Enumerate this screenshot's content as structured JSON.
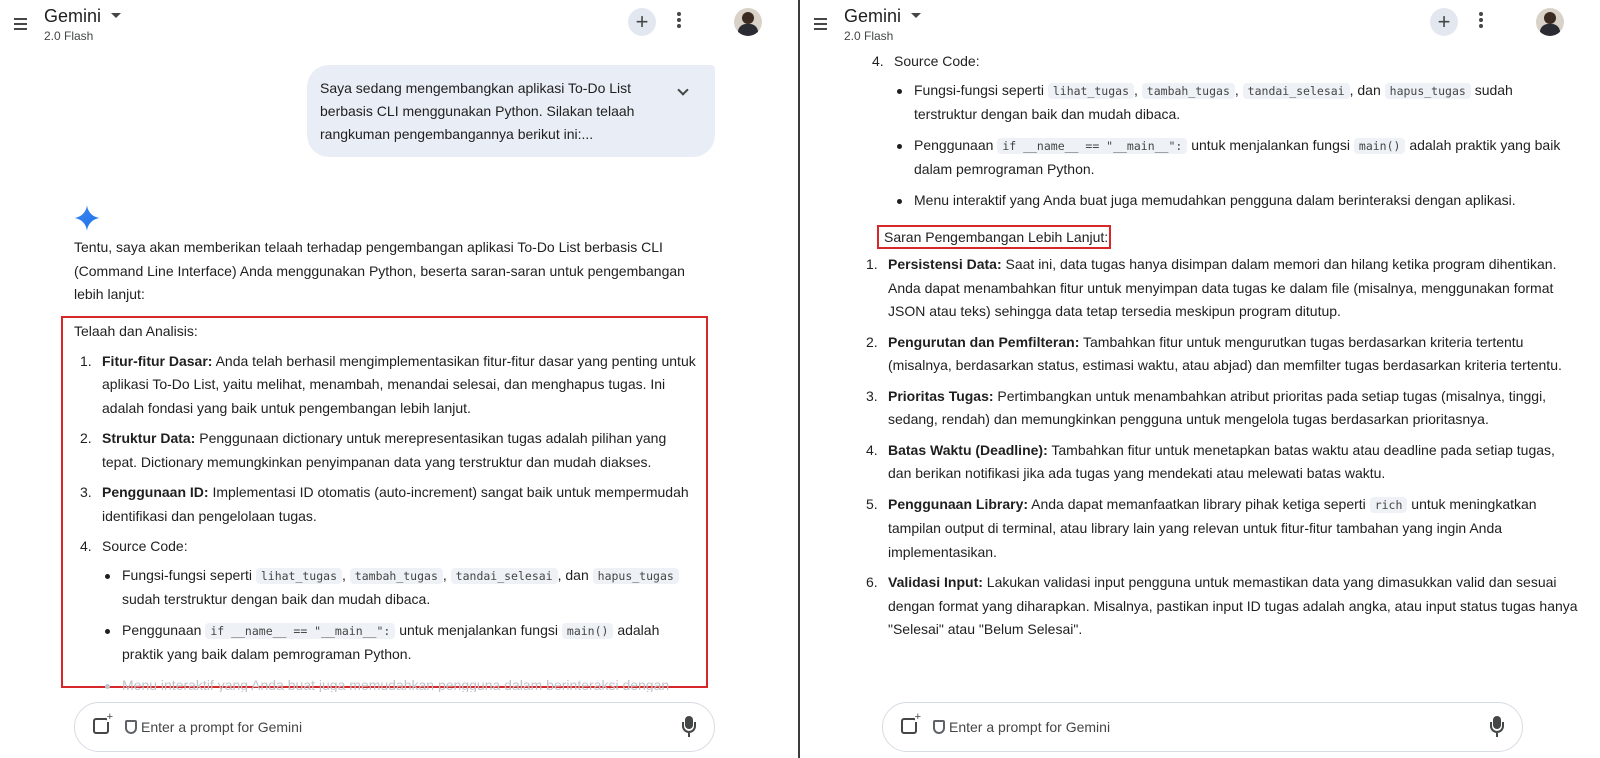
{
  "app": {
    "title": "Gemini",
    "model": "2.0 Flash",
    "input_placeholder": "Enter a prompt for Gemini"
  },
  "left": {
    "user_prompt": "Saya sedang mengembangkan aplikasi To-Do List berbasis CLI menggunakan Python. Silakan telaah rangkuman pengembangannya berikut ini:...",
    "intro": "Tentu, saya akan memberikan telaah terhadap pengembangan aplikasi To-Do List berbasis CLI (Command Line Interface) Anda menggunakan Python, beserta saran-saran untuk pengembangan lebih lanjut:",
    "section_title": "Telaah dan Analisis:",
    "items": [
      {
        "num": "1.",
        "bold": "Fitur-fitur Dasar:",
        "text": " Anda telah berhasil mengimplementasikan fitur-fitur dasar yang penting untuk aplikasi To-Do List, yaitu melihat, menambah, menandai selesai, dan menghapus tugas. Ini adalah fondasi yang baik untuk pengembangan lebih lanjut."
      },
      {
        "num": "2.",
        "bold": "Struktur Data:",
        "text": " Penggunaan dictionary untuk merepresentasikan tugas adalah pilihan yang tepat. Dictionary memungkinkan penyimpanan data yang terstruktur dan mudah diakses."
      },
      {
        "num": "3.",
        "bold": "Penggunaan ID:",
        "text": " Implementasi ID otomatis (auto-increment) sangat baik untuk mempermudah identifikasi dan pengelolaan tugas."
      },
      {
        "num": "4.",
        "bold": "",
        "text": "Source Code:"
      }
    ]
  },
  "source_code": {
    "b1_pre": "Fungsi-fungsi seperti ",
    "f1": "lihat_tugas",
    "sep1": ", ",
    "f2": "tambah_tugas",
    "sep2": ", ",
    "f3": "tandai_selesai",
    "sep3": ", dan ",
    "f4": "hapus_tugas",
    "b1_post": " sudah terstruktur dengan baik dan mudah dibaca.",
    "b2_pre": "Penggunaan ",
    "b2_code": "if __name__ == \"__main__\":",
    "b2_mid": " untuk menjalankan fungsi ",
    "b2_code2": "main()",
    "b2_post": " adalah praktik yang baik dalam pemrograman Python.",
    "b3": "Menu interaktif yang Anda buat juga memudahkan pengguna dalam berinteraksi dengan aplikasi."
  },
  "right": {
    "section_title": "Saran Pengembangan Lebih Lanjut:",
    "items": [
      {
        "num": "1.",
        "bold": "Persistensi Data:",
        "text": " Saat ini, data tugas hanya disimpan dalam memori dan hilang ketika program dihentikan. Anda dapat menambahkan fitur untuk menyimpan data tugas ke dalam file (misalnya, menggunakan format JSON atau teks) sehingga data tetap tersedia meskipun program ditutup."
      },
      {
        "num": "2.",
        "bold": "Pengurutan dan Pemfilteran:",
        "text": " Tambahkan fitur untuk mengurutkan tugas berdasarkan kriteria tertentu (misalnya, berdasarkan status, estimasi waktu, atau abjad) dan memfilter tugas berdasarkan kriteria tertentu."
      },
      {
        "num": "3.",
        "bold": "Prioritas Tugas:",
        "text": " Pertimbangkan untuk menambahkan atribut prioritas pada setiap tugas (misalnya, tinggi, sedang, rendah) dan memungkinkan pengguna untuk mengelola tugas berdasarkan prioritasnya."
      },
      {
        "num": "4.",
        "bold": "Batas Waktu (Deadline):",
        "text": " Tambahkan fitur untuk menetapkan batas waktu atau deadline pada setiap tugas, dan berikan notifikasi jika ada tugas yang mendekati atau melewati batas waktu."
      },
      {
        "num": "5.",
        "bold": "Penggunaan Library:",
        "text_pre": " Anda dapat memanfaatkan library pihak ketiga seperti ",
        "code": "rich",
        "text_post": " untuk meningkatkan tampilan output di terminal, atau library lain yang relevan untuk fitur-fitur tambahan yang ingin Anda implementasikan."
      },
      {
        "num": "6.",
        "bold": "Validasi Input:",
        "text": " Lakukan validasi input pengguna untuk memastikan data yang dimasukkan valid dan sesuai dengan format yang diharapkan. Misalnya, pastikan input ID tugas adalah angka, atau input status tugas hanya \"Selesai\" atau \"Belum Selesai\"."
      }
    ]
  },
  "colors": {
    "highlight_box": "#d62828",
    "user_bubble": "#e9eef6",
    "gemini_spark": "#4285f4"
  }
}
